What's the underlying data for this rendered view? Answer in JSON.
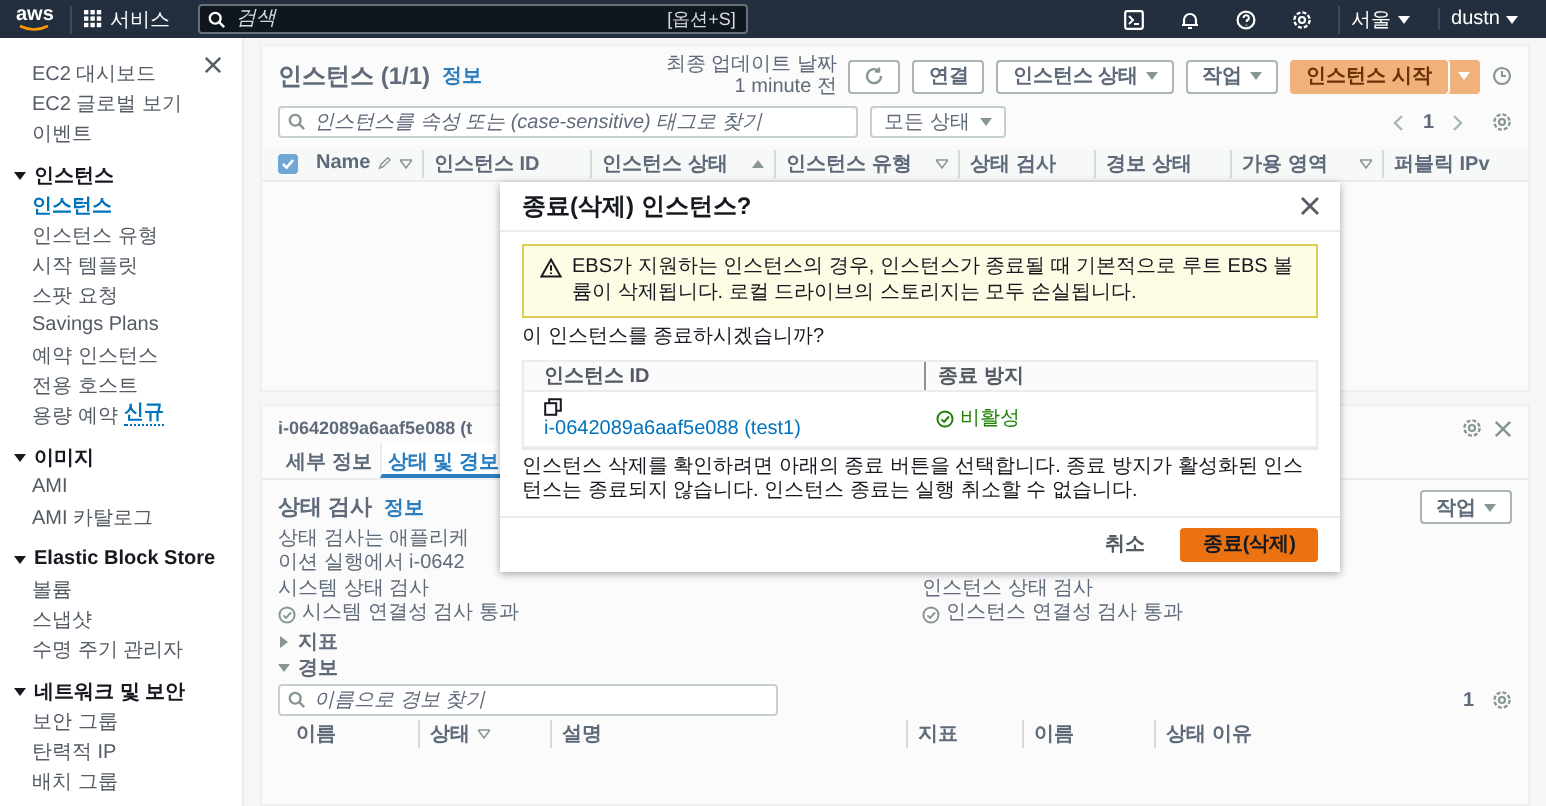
{
  "top_bar": {
    "logo": "aws",
    "services": "서비스",
    "search": {
      "placeholder": "검색",
      "shortcut": "[옵션+S]"
    },
    "region": "서울",
    "user": "dustn"
  },
  "sidebar": {
    "items": [
      {
        "label": "EC2 대시보드",
        "selected": false
      },
      {
        "label": "EC2 글로벌 보기",
        "selected": false
      },
      {
        "label": "이벤트",
        "selected": false
      }
    ],
    "groups": [
      {
        "title": "인스턴스",
        "expanded": true,
        "items": [
          {
            "label": "인스턴스",
            "selected": true
          },
          {
            "label": "인스턴스 유형",
            "selected": false
          },
          {
            "label": "시작 템플릿",
            "selected": false
          },
          {
            "label": "스팟 요청",
            "selected": false
          },
          {
            "label": "Savings Plans",
            "selected": false
          },
          {
            "label": "예약 인스턴스",
            "selected": false
          },
          {
            "label": "전용 호스트",
            "selected": false
          },
          {
            "label": "용량 예약",
            "selected": false,
            "badge": "신규"
          }
        ]
      },
      {
        "title": "이미지",
        "expanded": true,
        "items": [
          {
            "label": "AMI",
            "selected": false
          },
          {
            "label": "AMI 카탈로그",
            "selected": false
          }
        ]
      },
      {
        "title": "Elastic Block Store",
        "expanded": true,
        "items": [
          {
            "label": "볼륨",
            "selected": false
          },
          {
            "label": "스냅샷",
            "selected": false
          },
          {
            "label": "수명 주기 관리자",
            "selected": false
          }
        ]
      },
      {
        "title": "네트워크 및 보안",
        "expanded": true,
        "items": [
          {
            "label": "보안 그룹",
            "selected": false
          },
          {
            "label": "탄력적 IP",
            "selected": false
          },
          {
            "label": "배치 그룹",
            "selected": false
          }
        ]
      }
    ]
  },
  "instances_panel": {
    "title": "인스턴스 (1/1)",
    "info": "정보",
    "last_updated": "최종 업데이트 날짜",
    "last_updated_time": "1 minute 전",
    "buttons": [
      {
        "label": "연결",
        "kind": "plain"
      },
      {
        "label": "인스턴스 상태",
        "kind": "menu"
      },
      {
        "label": "작업",
        "kind": "menu"
      },
      {
        "label": "인스턴스 시작",
        "kind": "primary"
      }
    ],
    "search": {
      "placeholder": "인스턴스를 속성 또는 (case-sensitive) 태그로 찾기"
    },
    "state_filter": "모든 상태",
    "page": "1",
    "select_all_checked": true,
    "columns": [
      {
        "label": "Name",
        "editable": true,
        "filter": true,
        "sorted": false
      },
      {
        "label": "인스턴스 ID",
        "editable": false,
        "filter": false,
        "sorted": false
      },
      {
        "label": "인스턴스 상태",
        "editable": false,
        "filter": false,
        "sorted": true
      },
      {
        "label": "인스턴스 유형",
        "editable": false,
        "filter": true,
        "sorted": false
      },
      {
        "label": "상태 검사",
        "editable": false,
        "filter": false,
        "sorted": false
      },
      {
        "label": "경보 상태",
        "editable": false,
        "filter": false,
        "sorted": false
      },
      {
        "label": "가용 영역",
        "editable": false,
        "filter": true,
        "sorted": false
      },
      {
        "label": "퍼블릭 IPv",
        "editable": false,
        "filter": false,
        "sorted": false
      }
    ]
  },
  "detail_panel": {
    "title": "i-0642089a6aaf5e088 (t",
    "tabs": [
      {
        "label": "세부 정보",
        "selected": false
      },
      {
        "label": "상태 및 경보",
        "selected": true
      }
    ],
    "section": {
      "title": "상태 검사",
      "info": "정보",
      "action": "작업",
      "description": "상태 검사는 애플리케이션 실행에서 i-0642"
    },
    "checks": [
      {
        "label": "시스템 상태 검사",
        "result": "시스템 연결성 검사 통과"
      },
      {
        "label": "인스턴스 상태 검사",
        "result": "인스턴스 연결성 검사 통과"
      }
    ],
    "sections": [
      {
        "title": "지표",
        "expanded": false
      },
      {
        "title": "경보",
        "expanded": true
      }
    ],
    "alarm_search": {
      "placeholder": "이름으로 경보 찾기"
    },
    "page": "1",
    "columns": [
      {
        "label": "이름",
        "filter": false
      },
      {
        "label": "상태",
        "filter": true
      },
      {
        "label": "설명",
        "filter": false
      },
      {
        "label": "지표",
        "filter": false
      },
      {
        "label": "이름",
        "filter": false
      },
      {
        "label": "상태 이유",
        "filter": false
      }
    ]
  },
  "dialog": {
    "title": "종료(삭제) 인스턴스?",
    "warning": "EBS가 지원하는 인스턴스의 경우, 인스턴스가 종료될 때 기본적으로 루트 EBS 볼륨이 삭제됩니다. 로컬 드라이브의 스토리지는 모두 손실됩니다.",
    "question": "이 인스턴스를 종료하시겠습니까?",
    "columns": [
      "인스턴스 ID",
      "종료 방지"
    ],
    "rows": [
      {
        "instance": "i-0642089a6aaf5e088 (test1)",
        "protection": "비활성"
      }
    ],
    "note": "인스턴스 삭제를 확인하려면 아래의 종료 버튼을 선택합니다. 종료 방지가 활성화된 인스턴스는 종료되지 않습니다. 인스턴스 종료는 실행 취소할 수 없습니다.",
    "cancel": "취소",
    "confirm": "종료(삭제)"
  }
}
